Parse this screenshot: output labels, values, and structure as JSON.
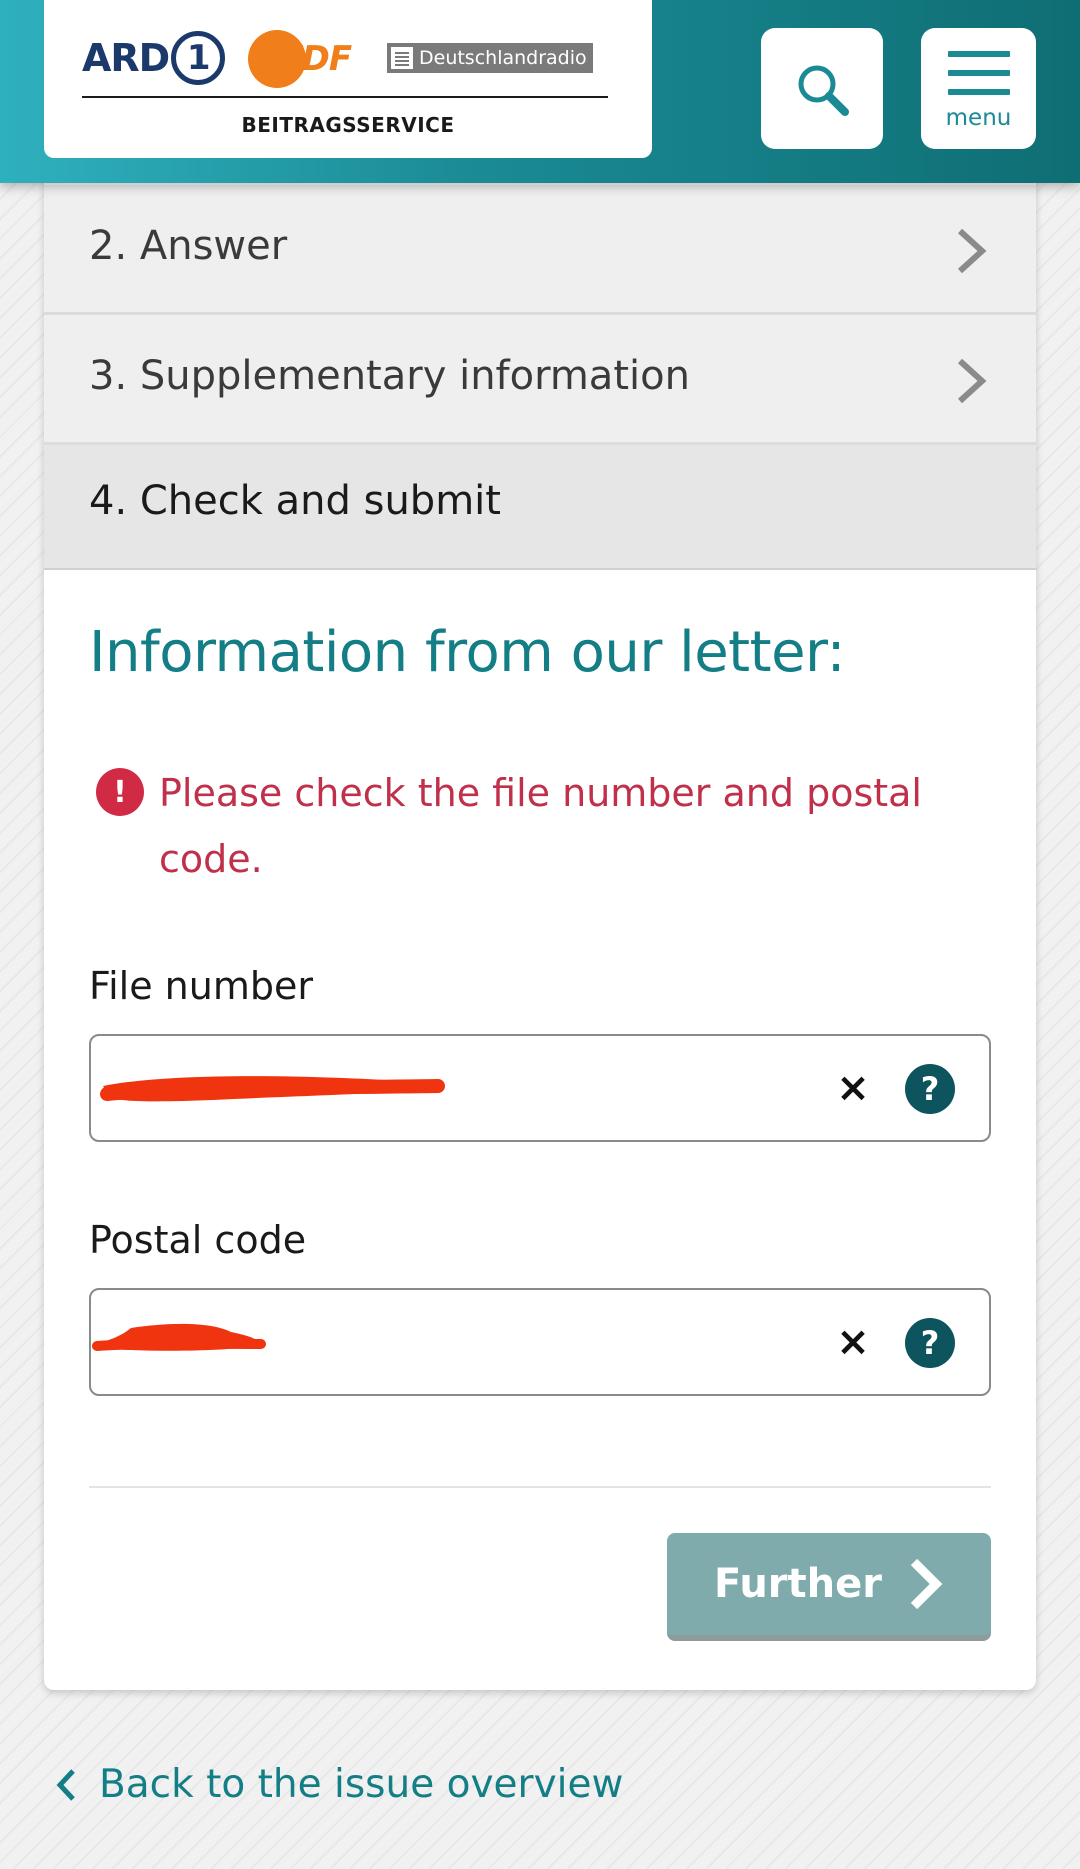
{
  "header": {
    "logo_ard": "ARD",
    "logo_ard_one": "1",
    "logo_zdf": "ZDF",
    "logo_dlr": "Deutschlandradio",
    "logo_sub": "BEITRAGSSERVICE",
    "menu_label": "menu",
    "accent": "#1a8a94"
  },
  "steps": [
    {
      "label": "2. Answer",
      "state": "collapsed"
    },
    {
      "label": "3. Supplementary information",
      "state": "collapsed"
    },
    {
      "label": "4. Check and submit",
      "state": "active"
    }
  ],
  "form": {
    "title": "Information from our letter:",
    "error_icon": "!",
    "error_message": "Please check the file number and postal code.",
    "error_color": "#c0304a",
    "fields": [
      {
        "label": "File number",
        "value": "",
        "clear": "×",
        "help": "?"
      },
      {
        "label": "Postal code",
        "value": "",
        "clear": "×",
        "help": "?"
      }
    ],
    "further_label": "Further",
    "further_color": "#80abad"
  },
  "back_link": "Back to the issue overview"
}
